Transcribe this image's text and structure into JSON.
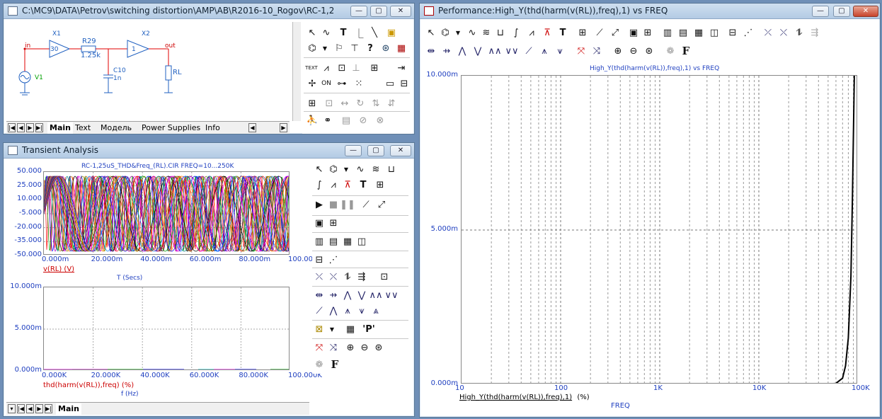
{
  "schematic": {
    "title": "C:\\MC9\\DATA\\Petrov\\switching distortion\\AMP\\AB\\R2016-10_Rogov\\RC-1,25uS_T...",
    "labels": {
      "x1": "X1",
      "gain1": "30",
      "r29": "R29",
      "r29_val": "1.25k",
      "x2": "X2",
      "gain2": "1",
      "c10": "C10",
      "c10_val": "1n",
      "rl": "RL",
      "v1": "V1",
      "in": "in",
      "out": "out"
    },
    "tabs": [
      "Main",
      "Text",
      "Модель",
      "Power Supplies",
      "Info"
    ],
    "active_tab": "Main",
    "icon_text": "TEXT"
  },
  "transient": {
    "title": "Transient Analysis",
    "plot1": {
      "header": "RC-1,25uS_THD&Freq_(RL).CIR FREQ=10...250K",
      "yticks": [
        "50.000",
        "25.000",
        "10.000",
        "-5.000",
        "-20.000",
        "-35.000",
        "-50.000"
      ],
      "xticks": [
        "0.000m",
        "20.000m",
        "40.000m",
        "60.000m",
        "80.000m",
        "100.000m"
      ],
      "trace_label": "v(RL) (V)",
      "xlabel": "T (Secs)"
    },
    "plot2": {
      "yticks": [
        "10.000m",
        "5.000m",
        "0.000m"
      ],
      "xticks": [
        "0.000K",
        "20.000K",
        "40.000K",
        "60.000K",
        "80.000K",
        "100.000K"
      ],
      "trace_label": "thd(harm(v(RL)),freq) (%)",
      "xlabel": "f (Hz)"
    },
    "tab": "Main",
    "colors": [
      "#ff0000",
      "#00a000",
      "#0000ff",
      "#c000c0",
      "#008080",
      "#c08000",
      "#000000",
      "#ff00ff",
      "#808000",
      "#ff8000",
      "#0080ff",
      "#800080"
    ]
  },
  "performance": {
    "title": "Performance:High_Y(thd(harm(v(RL)),freq),1) vs FREQ",
    "plot_header": "High_Y(thd(harm(v(RL)),freq),1) vs FREQ",
    "yticks": [
      "10.000m",
      "5.000m",
      "0.000m"
    ],
    "xticks": [
      "10",
      "100",
      "1K",
      "10K",
      "100K"
    ],
    "trace_label": "High_Y(thd(harm(v(RL)),freq),1)",
    "trace_unit": "(%)",
    "xlabel": "FREQ",
    "icon_f": "F"
  },
  "chart_data": [
    {
      "type": "line",
      "title": "High_Y(thd(harm(v(RL)),freq),1) vs FREQ",
      "xlabel": "FREQ",
      "ylabel": "High_Y(thd(harm(v(RL)),freq),1) (%)",
      "xscale": "log",
      "xlim": [
        10,
        100000
      ],
      "ylim": [
        0,
        0.01
      ],
      "grid": true,
      "series": [
        {
          "x": [
            10,
            1000,
            30000,
            50000,
            60000,
            70000,
            75000,
            80000,
            85000,
            88000,
            92000
          ],
          "y": [
            0,
            0,
            0,
            1e-05,
            3e-05,
            0.0002,
            0.0006,
            0.0015,
            0.0035,
            0.006,
            0.01
          ]
        }
      ]
    }
  ]
}
